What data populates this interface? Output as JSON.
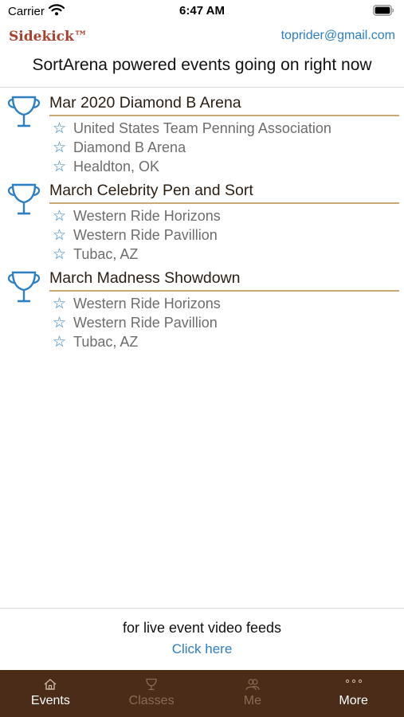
{
  "status_bar": {
    "carrier": "Carrier",
    "time": "6:47 AM"
  },
  "header": {
    "brand": "Sidekick™",
    "email": "toprider@gmail.com"
  },
  "page_title": "SortArena powered events going on right now",
  "events": [
    {
      "name": "Mar 2020 Diamond B Arena",
      "details": [
        "United States Team Penning Association",
        "Diamond B Arena",
        "Healdton, OK"
      ]
    },
    {
      "name": "March Celebrity Pen and Sort",
      "details": [
        "Western Ride Horizons",
        "Western Ride Pavillion",
        "Tubac, AZ"
      ]
    },
    {
      "name": "March Madness Showdown",
      "details": [
        "Western Ride Horizons",
        "Western Ride Pavillion",
        "Tubac, AZ"
      ]
    }
  ],
  "promo": {
    "text": "for live event video feeds",
    "link": "Click here"
  },
  "tabs": [
    {
      "label": "Events",
      "icon": "home-icon",
      "active": true
    },
    {
      "label": "Classes",
      "icon": "trophy-icon",
      "active": false
    },
    {
      "label": "Me",
      "icon": "people-icon",
      "active": false
    },
    {
      "label": "More",
      "icon": "more-dots-icon",
      "active": true
    }
  ],
  "colors": {
    "brand": "#a5432f",
    "link": "#2d7fc1",
    "accent_rule": "#c9a878",
    "tab_bar": "#4b2c18"
  }
}
